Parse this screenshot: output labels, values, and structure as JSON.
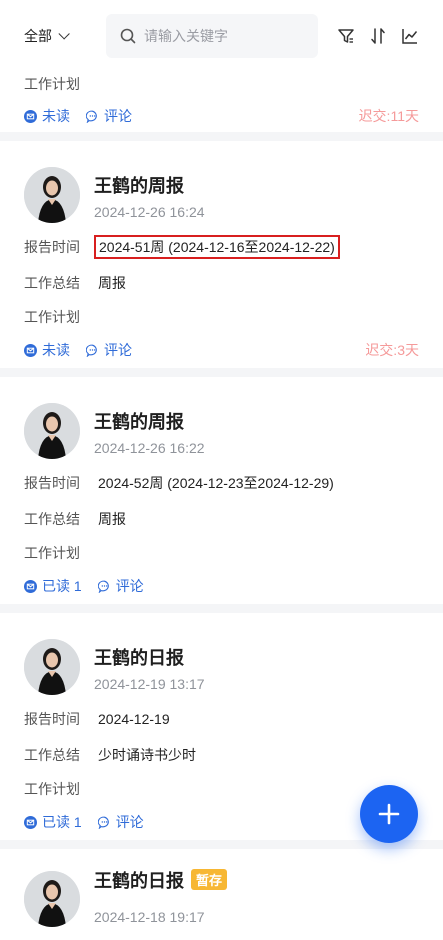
{
  "topbar": {
    "filter_label": "全部",
    "search_placeholder": "请输入关键字"
  },
  "reports": [
    {
      "plan_label": "工作计划",
      "read_status": "未读",
      "comment_label": "评论",
      "late": "迟交:11天"
    },
    {
      "name": "王鹤的周报",
      "time": "2024-12-26 16:24",
      "report_time_label": "报告时间",
      "report_time": "2024-51周 (2024-12-16至2024-12-22)",
      "summary_label": "工作总结",
      "summary": "周报",
      "plan_label": "工作计划",
      "read_status": "未读",
      "comment_label": "评论",
      "late": "迟交:3天"
    },
    {
      "name": "王鹤的周报",
      "time": "2024-12-26 16:22",
      "report_time_label": "报告时间",
      "report_time": "2024-52周 (2024-12-23至2024-12-29)",
      "summary_label": "工作总结",
      "summary": "周报",
      "plan_label": "工作计划",
      "read_status": "已读 1",
      "comment_label": "评论"
    },
    {
      "name": "王鹤的日报",
      "time": "2024-12-19 13:17",
      "report_time_label": "报告时间",
      "report_time": "2024-12-19",
      "summary_label": "工作总结",
      "summary": "少时诵诗书少时",
      "plan_label": "工作计划",
      "read_status": "已读 1",
      "comment_label": "评论"
    },
    {
      "name": "王鹤的日报",
      "badge": "暂存",
      "time": "2024-12-18 19:17"
    }
  ],
  "fab_icon": "plus-icon",
  "colors": {
    "accent": "#1c64f2",
    "late": "#f59a9a",
    "badge": "#f7b733",
    "highlight": "#d81f1f"
  }
}
